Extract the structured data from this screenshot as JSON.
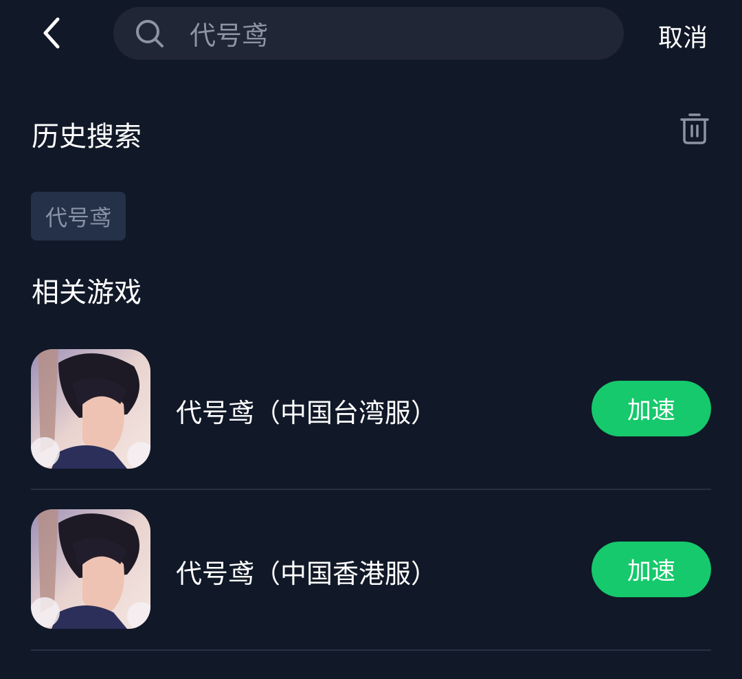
{
  "header": {
    "back_icon": "chevron-left-icon",
    "search": {
      "value": "代号鸢",
      "placeholder": "代号鸢",
      "icon": "search-icon"
    },
    "cancel_label": "取消"
  },
  "history": {
    "title": "历史搜索",
    "clear_icon": "trash-icon",
    "items": [
      "代号鸢"
    ]
  },
  "related": {
    "title": "相关游戏",
    "games": [
      {
        "name": "代号鸢（中国台湾服）",
        "action_label": "加速"
      },
      {
        "name": "代号鸢（中国香港服）",
        "action_label": "加速"
      }
    ]
  },
  "colors": {
    "background": "#111827",
    "search_bg": "#212636",
    "chip_bg": "#253149",
    "accent_green": "#16c96c",
    "divider": "#283042"
  }
}
